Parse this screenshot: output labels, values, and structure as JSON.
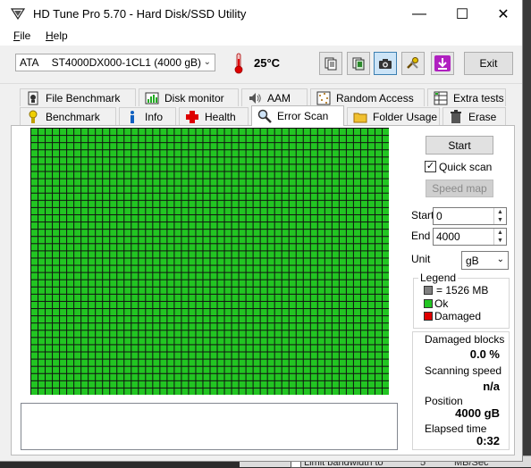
{
  "window": {
    "title": "HD Tune Pro 5.70 - Hard Disk/SSD Utility",
    "controls": {
      "minimize": "—",
      "maximize": "☐",
      "close": "✕"
    }
  },
  "menu": {
    "file": {
      "accel": "F",
      "rest": "ile"
    },
    "help": {
      "accel": "H",
      "rest": "elp"
    }
  },
  "toolbar": {
    "drive_interface": "ATA",
    "drive_model": "ST4000DX000-1CL1 (4000 gB)",
    "temperature": "25°C",
    "exit_label": "Exit",
    "icons": [
      "copy-text-icon",
      "copy-screenshot-icon",
      "camera-icon",
      "options-icon",
      "save-icon"
    ]
  },
  "tabs": {
    "top_row": [
      "File Benchmark",
      "Disk monitor",
      "AAM",
      "Random Access",
      "Extra tests"
    ],
    "bottom_row": [
      "Benchmark",
      "Info",
      "Health",
      "Error Scan",
      "Folder Usage",
      "Erase"
    ],
    "selected": "Error Scan"
  },
  "error_scan": {
    "start_button": "Start",
    "quick_scan_label": "Quick scan",
    "quick_scan_checked": true,
    "speed_map_button": "Speed map",
    "start_label": "Start",
    "start_value": "0",
    "end_label": "End",
    "end_value": "4000",
    "unit_label": "Unit",
    "unit_value": "gB",
    "legend": {
      "title": "Legend",
      "block_size": "= 1526 MB",
      "ok": "Ok",
      "damaged": "Damaged"
    },
    "stats": {
      "damaged_blocks_label": "Damaged blocks",
      "damaged_blocks_value": "0.0 %",
      "scanning_speed_label": "Scanning speed",
      "scanning_speed_value": "n/a",
      "position_label": "Position",
      "position_value": "4000 gB",
      "elapsed_time_label": "Elapsed time",
      "elapsed_time_value": "0:32"
    },
    "grid": {
      "columns": 50,
      "rows": 37,
      "ok_fraction": 1.0
    }
  },
  "colors": {
    "ok_block": "#22c522",
    "grid_line": "#111111",
    "damaged_block": "#e00000",
    "block_size_swatch": "#808080"
  },
  "background_window": {
    "limit_bandwidth_label": "Limit bandwidth to",
    "value": "5",
    "unit": "MB/Sec"
  }
}
